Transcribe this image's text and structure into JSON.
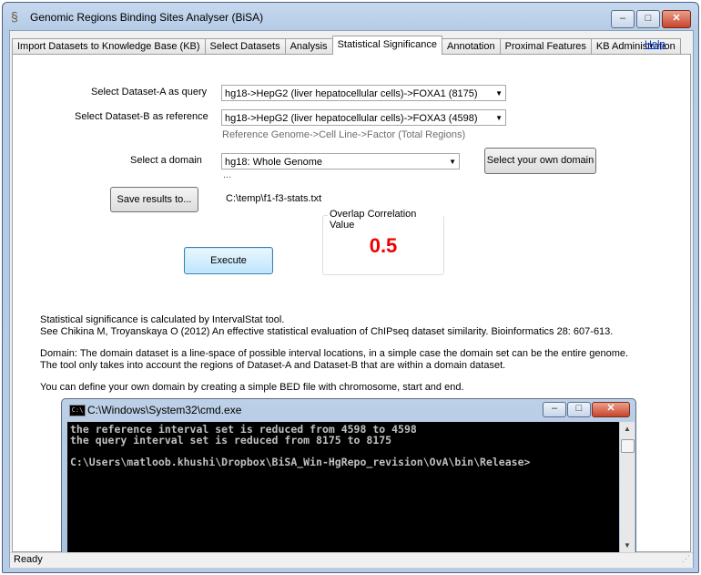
{
  "window": {
    "title": "Genomic Regions Binding Sites Analyser (BiSA)",
    "icon": "dna-icon",
    "controls": {
      "minimize": "–",
      "maximize": "□",
      "close": "✕"
    }
  },
  "tabs": [
    {
      "label": "Import Datasets to Knowledge Base (KB)",
      "active": false
    },
    {
      "label": "Select Datasets",
      "active": false
    },
    {
      "label": "Analysis",
      "active": false
    },
    {
      "label": "Statistical Significance",
      "active": true
    },
    {
      "label": "Annotation",
      "active": false
    },
    {
      "label": "Proximal Features",
      "active": false
    },
    {
      "label": "KB Administration",
      "active": false
    }
  ],
  "help_link": "Help",
  "form": {
    "dataset_a_label": "Select Dataset-A as query",
    "dataset_a_value": "hg18->HepG2 (liver hepatocellular cells)->FOXA1 (8175)",
    "dataset_b_label": "Select Dataset-B as reference",
    "dataset_b_value": "hg18->HepG2 (liver hepatocellular cells)->FOXA3 (4598)",
    "dataset_hint": "Reference Genome->Cell Line->Factor (Total Regions)",
    "domain_label": "Select a domain",
    "domain_value": "hg18: Whole Genome",
    "domain_ellipsis": "...",
    "own_domain_button": "Select your own domain",
    "save_button": "Save results to...",
    "save_path": "C:\\temp\\f1-f3-stats.txt",
    "execute_button": "Execute"
  },
  "result": {
    "title": "Overlap Correlation Value",
    "value": "0.5",
    "value_color": "#ee0000"
  },
  "info": {
    "line1": "Statistical significance is calculated by IntervalStat tool.",
    "line2": "See Chikina M, Troyanskaya O (2012) An effective statistical evaluation of ChIPseq dataset similarity. Bioinformatics 28: 607-613.",
    "line3": "Domain: The domain dataset is a line-space of possible interval locations, in a simple case the domain set can be the entire genome.",
    "line4": "The tool only takes into account the regions of Dataset-A and Dataset-B that are within a domain dataset.",
    "line5": "You can define your own domain by creating a simple BED file with chromosome, start and end."
  },
  "console": {
    "title": "C:\\Windows\\System32\\cmd.exe",
    "icon_text": "C:\\",
    "lines": [
      "the reference interval set is reduced from 4598 to 4598",
      "the query interval set is reduced from 8175 to 8175",
      "",
      "C:\\Users\\matloob.khushi\\Dropbox\\BiSA_Win-HgRepo_revision\\OvA\\bin\\Release>"
    ]
  },
  "status": {
    "text": "Ready"
  }
}
